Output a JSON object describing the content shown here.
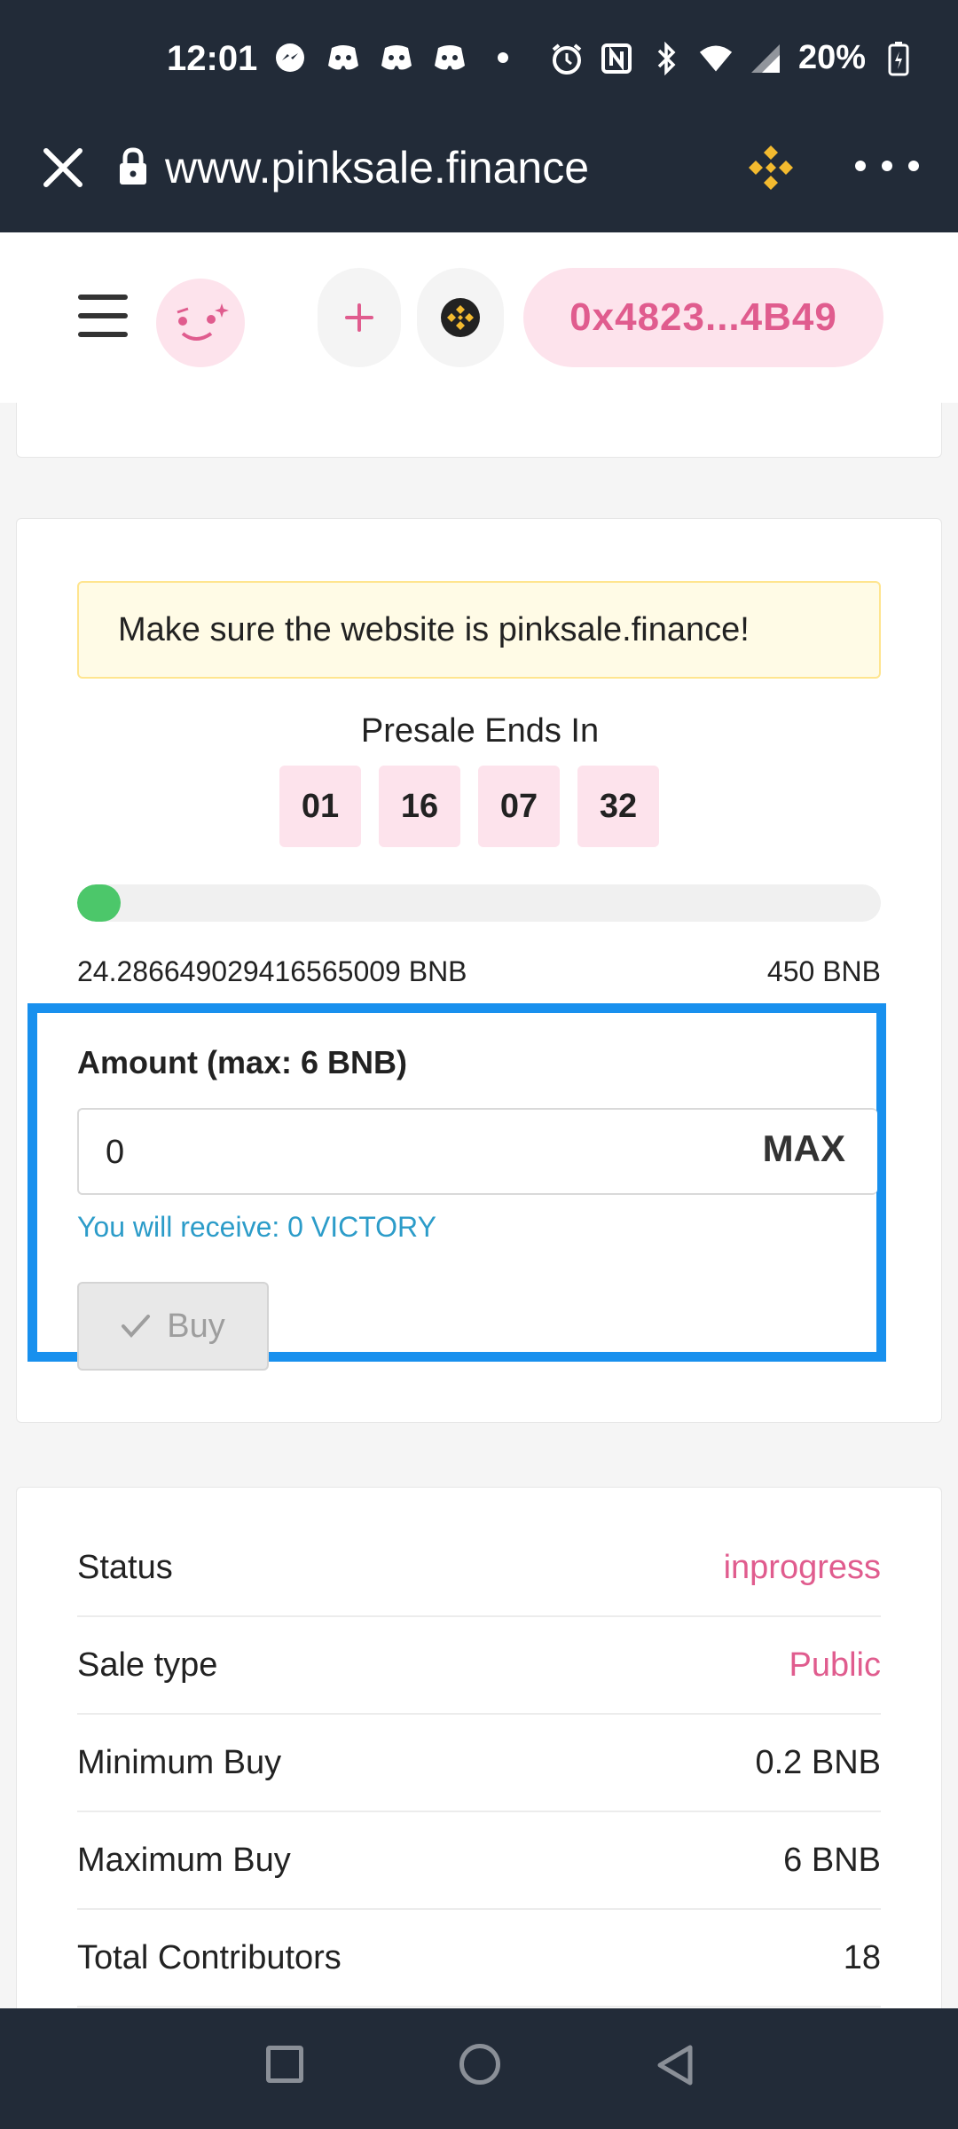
{
  "status_bar": {
    "time": "12:01",
    "battery": "20%",
    "icons": [
      "messenger-icon",
      "discord-icon",
      "discord-icon",
      "discord-icon",
      "dot-icon",
      "alarm-icon",
      "nfc-icon",
      "bluetooth-icon",
      "wifi-icon",
      "signal-icon",
      "battery-icon"
    ]
  },
  "browser": {
    "url": "www.pinksale.finance"
  },
  "header": {
    "wallet_address": "0x4823...4B49",
    "plus_label": "+"
  },
  "warning": "Make sure the website is pinksale.finance!",
  "presale": {
    "title": "Presale Ends In",
    "countdown": [
      "01",
      "16",
      "07",
      "32"
    ],
    "progress_fraction": 0.054,
    "raised": "24.286649029416565009 BNB",
    "hardcap": "450 BNB"
  },
  "buy": {
    "amount_label": "Amount (max: 6 BNB)",
    "amount_value": "0",
    "max_label": "MAX",
    "receive_text": "You will receive: 0 VICTORY",
    "buy_label": "Buy"
  },
  "info": [
    {
      "label": "Status",
      "value": "inprogress"
    },
    {
      "label": "Sale type",
      "value": "Public"
    },
    {
      "label": "Minimum Buy",
      "value": "0.2 BNB"
    },
    {
      "label": "Maximum Buy",
      "value": "6 BNB"
    },
    {
      "label": "Total Contributors",
      "value": "18"
    }
  ],
  "colors": {
    "accent_pink": "#e05c8e",
    "highlight_blue": "#1890ee",
    "progress_green": "#4cc76a",
    "dark_bar": "#222b38"
  }
}
